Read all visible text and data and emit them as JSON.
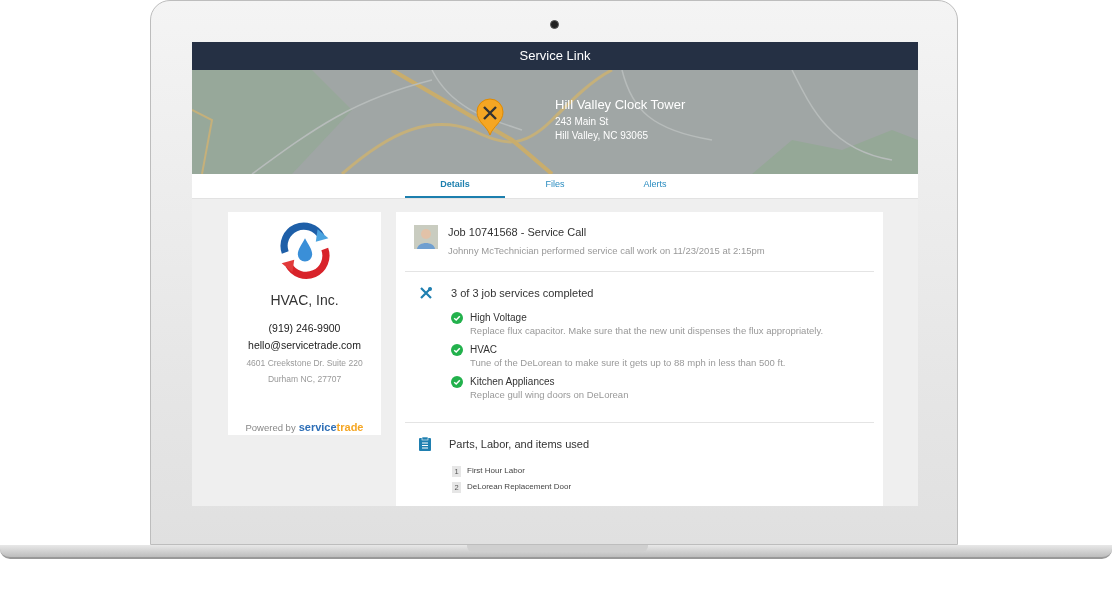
{
  "window": {
    "title": "Service Link"
  },
  "location": {
    "name": "Hill Valley Clock Tower",
    "street": "243 Main St",
    "city": "Hill Valley, NC 93065"
  },
  "tabs": [
    {
      "label": "Details",
      "selected": true
    },
    {
      "label": "Files",
      "selected": false
    },
    {
      "label": "Alerts",
      "selected": false
    }
  ],
  "company": {
    "name": "HVAC, Inc.",
    "phone": "(919) 246-9900",
    "email": "hello@servicetrade.com",
    "address_line_1": "4601 Creekstone Dr. Suite 220",
    "address_line_2": "Durham NC, 27707",
    "powered_by": "Powered by",
    "brand_parts": [
      "service",
      "trade"
    ]
  },
  "job": {
    "title": "Job 10741568 - Service Call",
    "summary": "Johnny McTechnician performed service call work on 11/23/2015 at 2:15pm"
  },
  "services": {
    "heading": "3 of 3 job services completed",
    "items": [
      {
        "name": "High Voltage",
        "description": "Replace flux capacitor. Make sure that the new unit dispenses the flux appropriately.",
        "completed": true
      },
      {
        "name": "HVAC",
        "description": "Tune of the DeLorean to make sure it gets up to 88 mph in less than 500 ft.",
        "completed": true
      },
      {
        "name": "Kitchen Appliances",
        "description": "Replace gull wing doors on DeLorean",
        "completed": true
      }
    ]
  },
  "parts": {
    "heading": "Parts, Labor, and items used",
    "items": [
      {
        "number": "1",
        "name": "First Hour Labor"
      },
      {
        "number": "2",
        "name": "DeLorean Replacement Door"
      }
    ]
  }
}
